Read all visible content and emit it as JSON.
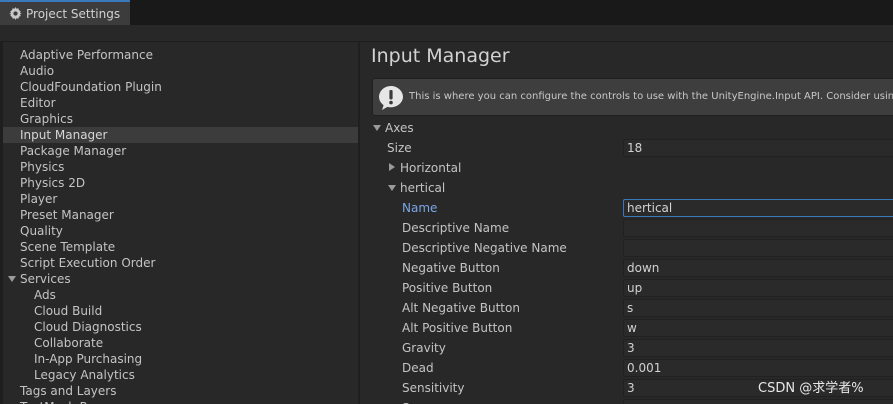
{
  "window": {
    "tab_title": "Project Settings"
  },
  "sidebar": {
    "items": [
      {
        "label": "Adaptive Performance",
        "indent": 0,
        "selected": false
      },
      {
        "label": "Audio",
        "indent": 0,
        "selected": false
      },
      {
        "label": "CloudFoundation Plugin",
        "indent": 0,
        "selected": false
      },
      {
        "label": "Editor",
        "indent": 0,
        "selected": false
      },
      {
        "label": "Graphics",
        "indent": 0,
        "selected": false
      },
      {
        "label": "Input Manager",
        "indent": 0,
        "selected": true
      },
      {
        "label": "Package Manager",
        "indent": 0,
        "selected": false
      },
      {
        "label": "Physics",
        "indent": 0,
        "selected": false
      },
      {
        "label": "Physics 2D",
        "indent": 0,
        "selected": false
      },
      {
        "label": "Player",
        "indent": 0,
        "selected": false
      },
      {
        "label": "Preset Manager",
        "indent": 0,
        "selected": false
      },
      {
        "label": "Quality",
        "indent": 0,
        "selected": false
      },
      {
        "label": "Scene Template",
        "indent": 0,
        "selected": false
      },
      {
        "label": "Script Execution Order",
        "indent": 0,
        "selected": false
      },
      {
        "label": "Services",
        "indent": 0,
        "selected": false,
        "expanded": true
      },
      {
        "label": "Ads",
        "indent": 1,
        "selected": false
      },
      {
        "label": "Cloud Build",
        "indent": 1,
        "selected": false
      },
      {
        "label": "Cloud Diagnostics",
        "indent": 1,
        "selected": false
      },
      {
        "label": "Collaborate",
        "indent": 1,
        "selected": false
      },
      {
        "label": "In-App Purchasing",
        "indent": 1,
        "selected": false
      },
      {
        "label": "Legacy Analytics",
        "indent": 1,
        "selected": false
      },
      {
        "label": "Tags and Layers",
        "indent": 0,
        "selected": false
      },
      {
        "label": "TextMesh Pro",
        "indent": 0,
        "selected": false
      }
    ]
  },
  "main": {
    "title": "Input Manager",
    "help_text": "This is where you can configure the controls to use with the UnityEngine.Input API. Consider using the new Input System Package instead.",
    "axes": {
      "label": "Axes",
      "size_label": "Size",
      "size_value": "18",
      "collapsed_axis": "Horizontal",
      "expanded_axis": "hertical",
      "properties": [
        {
          "label": "Name",
          "value": "hertical",
          "active": true
        },
        {
          "label": "Descriptive Name",
          "value": ""
        },
        {
          "label": "Descriptive Negative Name",
          "value": ""
        },
        {
          "label": "Negative Button",
          "value": "down"
        },
        {
          "label": "Positive Button",
          "value": "up"
        },
        {
          "label": "Alt Negative Button",
          "value": "s"
        },
        {
          "label": "Alt Positive Button",
          "value": "w"
        },
        {
          "label": "Gravity",
          "value": "3"
        },
        {
          "label": "Dead",
          "value": "0.001"
        },
        {
          "label": "Sensitivity",
          "value": "3"
        },
        {
          "label": "Snap",
          "value": ""
        }
      ]
    }
  },
  "watermark": "CSDN @求学者%"
}
